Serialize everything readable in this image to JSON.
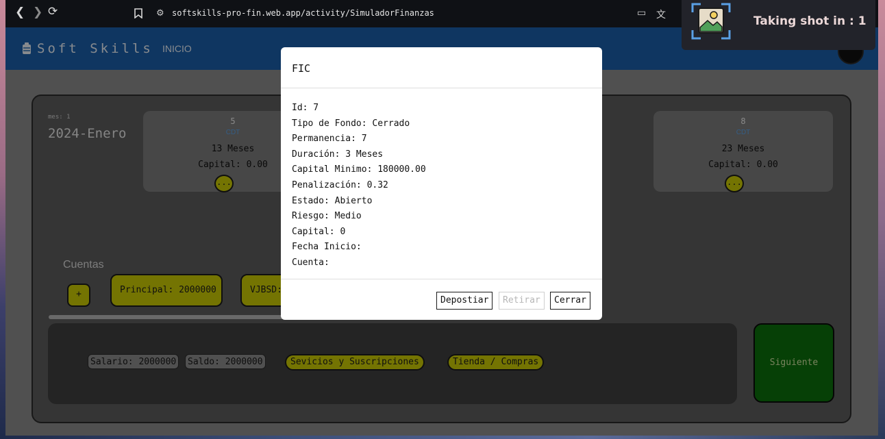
{
  "browser": {
    "url": "softskills-pro-fin.web.app/activity/SimuladorFinanzas",
    "back_icon": "chevron-left-icon",
    "forward_icon": "chevron-right-icon",
    "reload_icon": "reload-icon",
    "bookmark_icon": "bookmark-icon",
    "site_info_icon": "site-settings-icon",
    "cast_icon": "cast-icon",
    "translate_icon": "translate-icon"
  },
  "header": {
    "brand": "Soft Skills",
    "nav_home": "INICIO",
    "brand_color": "#1a5ea8"
  },
  "simulation": {
    "mes_label": "mes: 1",
    "date_label": "2024-Enero"
  },
  "products": [
    {
      "number": "5",
      "type": "CDT",
      "months": "13 Meses",
      "capital": "Capital: 0.00",
      "more_label": "..."
    },
    {
      "number": "8",
      "type": "CDT",
      "months": "23 Meses",
      "capital": "Capital: 0.00",
      "more_label": "..."
    }
  ],
  "accounts": {
    "title": "Cuentas",
    "add_label": "+",
    "items": [
      {
        "label": "Principal: 2000000"
      },
      {
        "label": "VJBSD:"
      }
    ]
  },
  "bottom_bar": {
    "salary": "Salario: 2000000",
    "balance": "Saldo: 2000000",
    "services_label": "Sevicios y Suscripciones",
    "store_label": "Tienda / Compras",
    "next_label": "Siguiente",
    "accent_color": "#c9c904",
    "next_color": "#0b6e0b"
  },
  "modal": {
    "title": "FIC",
    "fields": [
      "Id: 7",
      "Tipo de Fondo: Cerrado",
      "Permanencia: 7",
      "Duración: 3 Meses",
      "Capital Minimo: 180000.00",
      "Penalización: 0.32",
      "Estado: Abierto",
      "Riesgo: Medio",
      "Capital: 0",
      "Fecha Inicio:",
      "Cuenta:"
    ],
    "deposit_label": "Depostiar",
    "withdraw_label": "Retirar",
    "close_label": "Cerrar"
  },
  "screenshot_toast": {
    "text": "Taking shot in : 1",
    "icon": "screenshot-icon"
  }
}
